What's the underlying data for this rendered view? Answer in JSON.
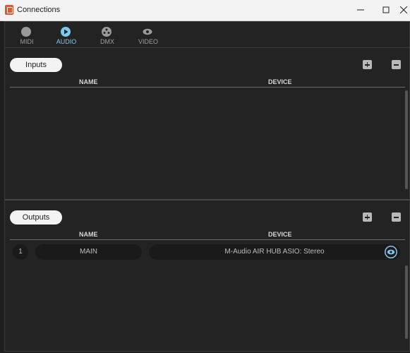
{
  "window": {
    "title": "Connections"
  },
  "tabs": [
    {
      "label": "MIDI",
      "icon": "midi-icon"
    },
    {
      "label": "AUDIO",
      "icon": "play-icon",
      "active": true
    },
    {
      "label": "DMX",
      "icon": "dmx-icon"
    },
    {
      "label": "VIDEO",
      "icon": "eye-icon"
    }
  ],
  "inputs": {
    "label": "Inputs",
    "columns": {
      "name": "NAME",
      "device": "DEVICE"
    },
    "rows": []
  },
  "outputs": {
    "label": "Outputs",
    "columns": {
      "name": "NAME",
      "device": "DEVICE"
    },
    "rows": [
      {
        "index": "1",
        "name": "MAIN",
        "device": "M-Audio AIR HUB ASIO: Stereo"
      }
    ]
  },
  "colors": {
    "accent": "#7ec8ef",
    "background": "#232323"
  }
}
